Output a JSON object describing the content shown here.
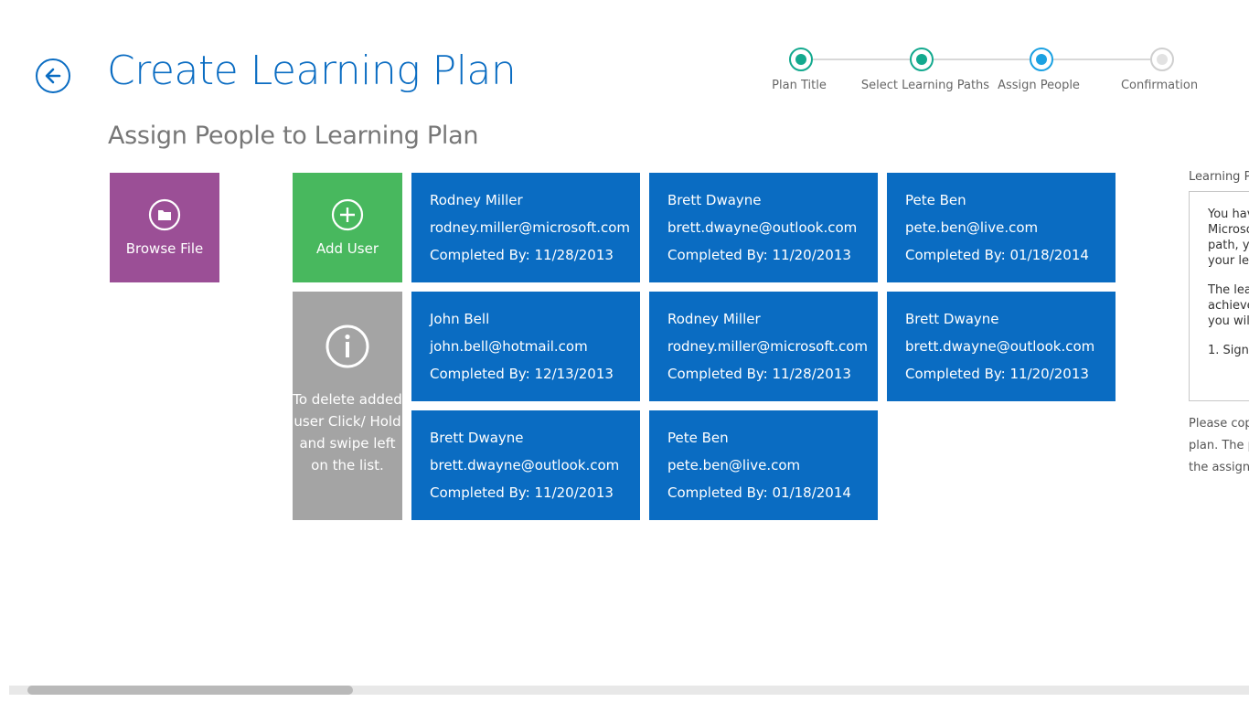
{
  "header": {
    "title": "Create Learning Plan",
    "subtitle": "Assign People to Learning Plan"
  },
  "colors": {
    "accent": "#0a6cc2",
    "step_complete": "#13a98e",
    "step_current": "#1ba1e2",
    "browse_tile": "#9b4f96",
    "add_tile": "#48b85e",
    "info_tile": "#a4a4a4",
    "user_tile": "#0a6cc2"
  },
  "stepper": {
    "steps": [
      {
        "label": "Plan Title",
        "state": "complete"
      },
      {
        "label": "Select Learning Paths",
        "state": "complete"
      },
      {
        "label": "Assign People",
        "state": "current"
      },
      {
        "label": "Confirmation",
        "state": "pending"
      }
    ]
  },
  "actions": {
    "browse_label": "Browse File",
    "browse_icon": "folder-icon",
    "add_label": "Add User",
    "add_icon": "plus-circle-icon",
    "info_icon": "info-icon",
    "info_text": "To delete added user Click/ Hold and swipe left on the list."
  },
  "users": [
    {
      "name": "Rodney Miller",
      "email": "rodney.miller@microsoft.com",
      "completed": "Completed By: 11/28/2013"
    },
    {
      "name": "Brett Dwayne",
      "email": "brett.dwayne@outlook.com",
      "completed": "Completed By: 11/20/2013"
    },
    {
      "name": "Pete Ben",
      "email": "pete.ben@live.com",
      "completed": "Completed By: 01/18/2014"
    },
    {
      "name": "John Bell",
      "email": "john.bell@hotmail.com",
      "completed": "Completed By: 12/13/2013"
    },
    {
      "name": "Rodney Miller",
      "email": "rodney.miller@microsoft.com",
      "completed": "Completed By: 11/28/2013"
    },
    {
      "name": "Brett Dwayne",
      "email": "brett.dwayne@outlook.com",
      "completed": "Completed By: 11/20/2013"
    },
    {
      "name": "Brett Dwayne",
      "email": "brett.dwayne@outlook.com",
      "completed": "Completed By: 11/20/2013"
    },
    {
      "name": "Pete Ben",
      "email": "pete.ben@live.com",
      "completed": "Completed By: 01/18/2014"
    }
  ],
  "side_panel": {
    "label": "Learning Pa",
    "lines_a": [
      "You hav",
      "Microso",
      "path, yo",
      "your lea"
    ],
    "lines_b": [
      "The lear",
      "achieve",
      "you will"
    ],
    "lines_c": [
      "1. Sign"
    ],
    "note_lines": [
      "Please cop",
      "plan. The p",
      "the assignn"
    ]
  }
}
